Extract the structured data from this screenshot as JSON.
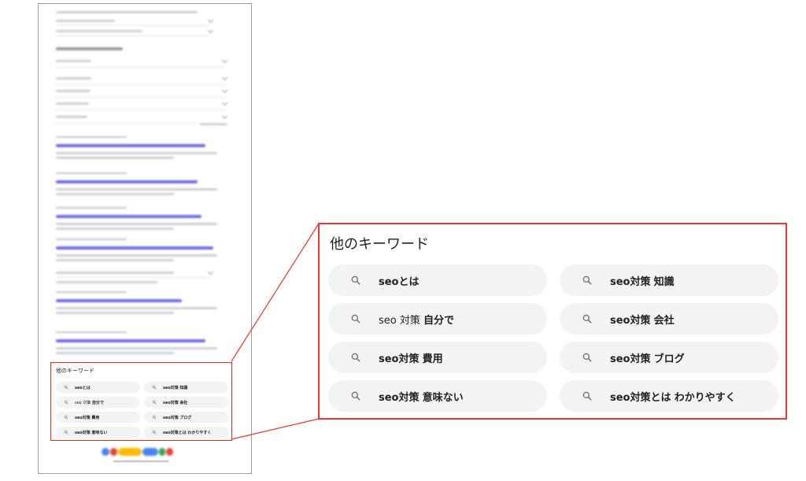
{
  "mini_panel": {
    "title": "他のキーワード",
    "chips": [
      {
        "pre": "seoとは",
        "mid": "",
        "bold": ""
      },
      {
        "pre": "seo対策",
        "mid": " ",
        "bold": "知識"
      },
      {
        "pre": "",
        "mid": "seo 対策 ",
        "bold": "自分で"
      },
      {
        "pre": "seo対策",
        "mid": " ",
        "bold": "会社"
      },
      {
        "pre": "seo対策",
        "mid": " ",
        "bold": "費用"
      },
      {
        "pre": "seo対策",
        "mid": " ",
        "bold": "ブログ"
      },
      {
        "pre": "seo対策",
        "mid": " ",
        "bold": "意味ない"
      },
      {
        "pre": "seo対策とは",
        "mid": " ",
        "bold": "わかりやすく"
      }
    ]
  },
  "zoom_panel": {
    "title": "他のキーワード",
    "chips": [
      {
        "pre": "seoとは",
        "mid": "",
        "bold": ""
      },
      {
        "pre": "seo対策",
        "mid": " ",
        "bold": "知識"
      },
      {
        "pre": "",
        "mid": "seo 対策 ",
        "bold": "自分で"
      },
      {
        "pre": "seo対策",
        "mid": " ",
        "bold": "会社"
      },
      {
        "pre": "seo対策",
        "mid": " ",
        "bold": "費用"
      },
      {
        "pre": "seo対策",
        "mid": " ",
        "bold": "ブログ"
      },
      {
        "pre": "seo対策",
        "mid": " ",
        "bold": "意味ない"
      },
      {
        "pre": "seo対策とは",
        "mid": " ",
        "bold": "わかりやすく"
      }
    ]
  },
  "colors": {
    "highlight_border": "#e53935",
    "chip_background": "#f1f3f4",
    "link_blue": "#6f6ee0"
  },
  "icons": {
    "chip_icon": "search-icon",
    "logo": "google-logo"
  }
}
